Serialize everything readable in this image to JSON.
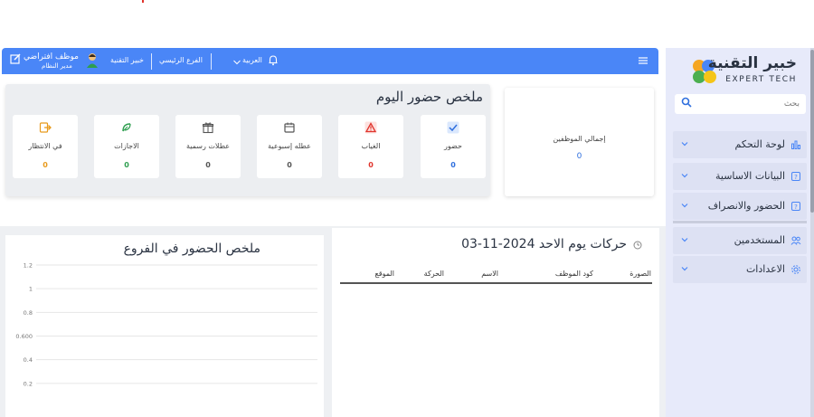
{
  "brand": {
    "title": "خبير التقنية",
    "subtitle": "EXPERT TECH",
    "dot_colors": [
      "#f5a623",
      "#4a86f7",
      "#4caf50",
      "#f5c518"
    ]
  },
  "search": {
    "placeholder": "بحث"
  },
  "sidebar": {
    "items": [
      {
        "label": "لوحة التحكم",
        "icon": "dashboard-icon",
        "active": true
      },
      {
        "label": "البيانات الاساسية",
        "icon": "database-icon"
      },
      {
        "label": "الحضور والانصراف",
        "icon": "attendance-icon"
      },
      {
        "label": "المستخدمين",
        "icon": "users-icon"
      },
      {
        "label": "الاعدادات",
        "icon": "settings-icon"
      }
    ]
  },
  "topbar": {
    "user_name": "موظف افتراضي",
    "user_role": "مدير النظام",
    "company": "خبير التقنية",
    "branch": "الفرع الرئيسي",
    "language": "العربية",
    "accent": "#4a86f7"
  },
  "summary": {
    "title": "ملخص حضور اليوم",
    "cards": [
      {
        "label": "حضور",
        "value": "0",
        "color": "#2f6fde",
        "icon": "check-icon"
      },
      {
        "label": "الغياب",
        "value": "0",
        "color": "#e0342c",
        "icon": "warning-icon"
      },
      {
        "label": "عطله إسبوعية",
        "value": "0",
        "color": "#555555",
        "icon": "calendar-icon"
      },
      {
        "label": "عطلات رسمية",
        "value": "0",
        "color": "#555555",
        "icon": "gift-icon"
      },
      {
        "label": "الاجازات",
        "value": "0",
        "color": "#2e9e4f",
        "icon": "leave-icon"
      },
      {
        "label": "في الانتظار",
        "value": "0",
        "color": "#e89a1c",
        "icon": "pending-icon"
      }
    ]
  },
  "total": {
    "label": "إجمالي الموظفين",
    "value": "0"
  },
  "branches_chart": {
    "title": "ملخص الحضور في الفروع"
  },
  "chart_data": {
    "type": "bar",
    "title": "ملخص الحضور في الفروع",
    "categories": [],
    "series": [],
    "ylim": [
      0,
      1.2
    ],
    "yticks": [
      "1.2",
      "1",
      "0.8",
      "0.600",
      "0.4",
      "0.2"
    ],
    "grid": true
  },
  "movements": {
    "title": "حركات يوم الاحد 2024-11-03",
    "columns": [
      "الصورة",
      "كود الموظف",
      "الاسم",
      "الحركة",
      "الموقع"
    ]
  }
}
